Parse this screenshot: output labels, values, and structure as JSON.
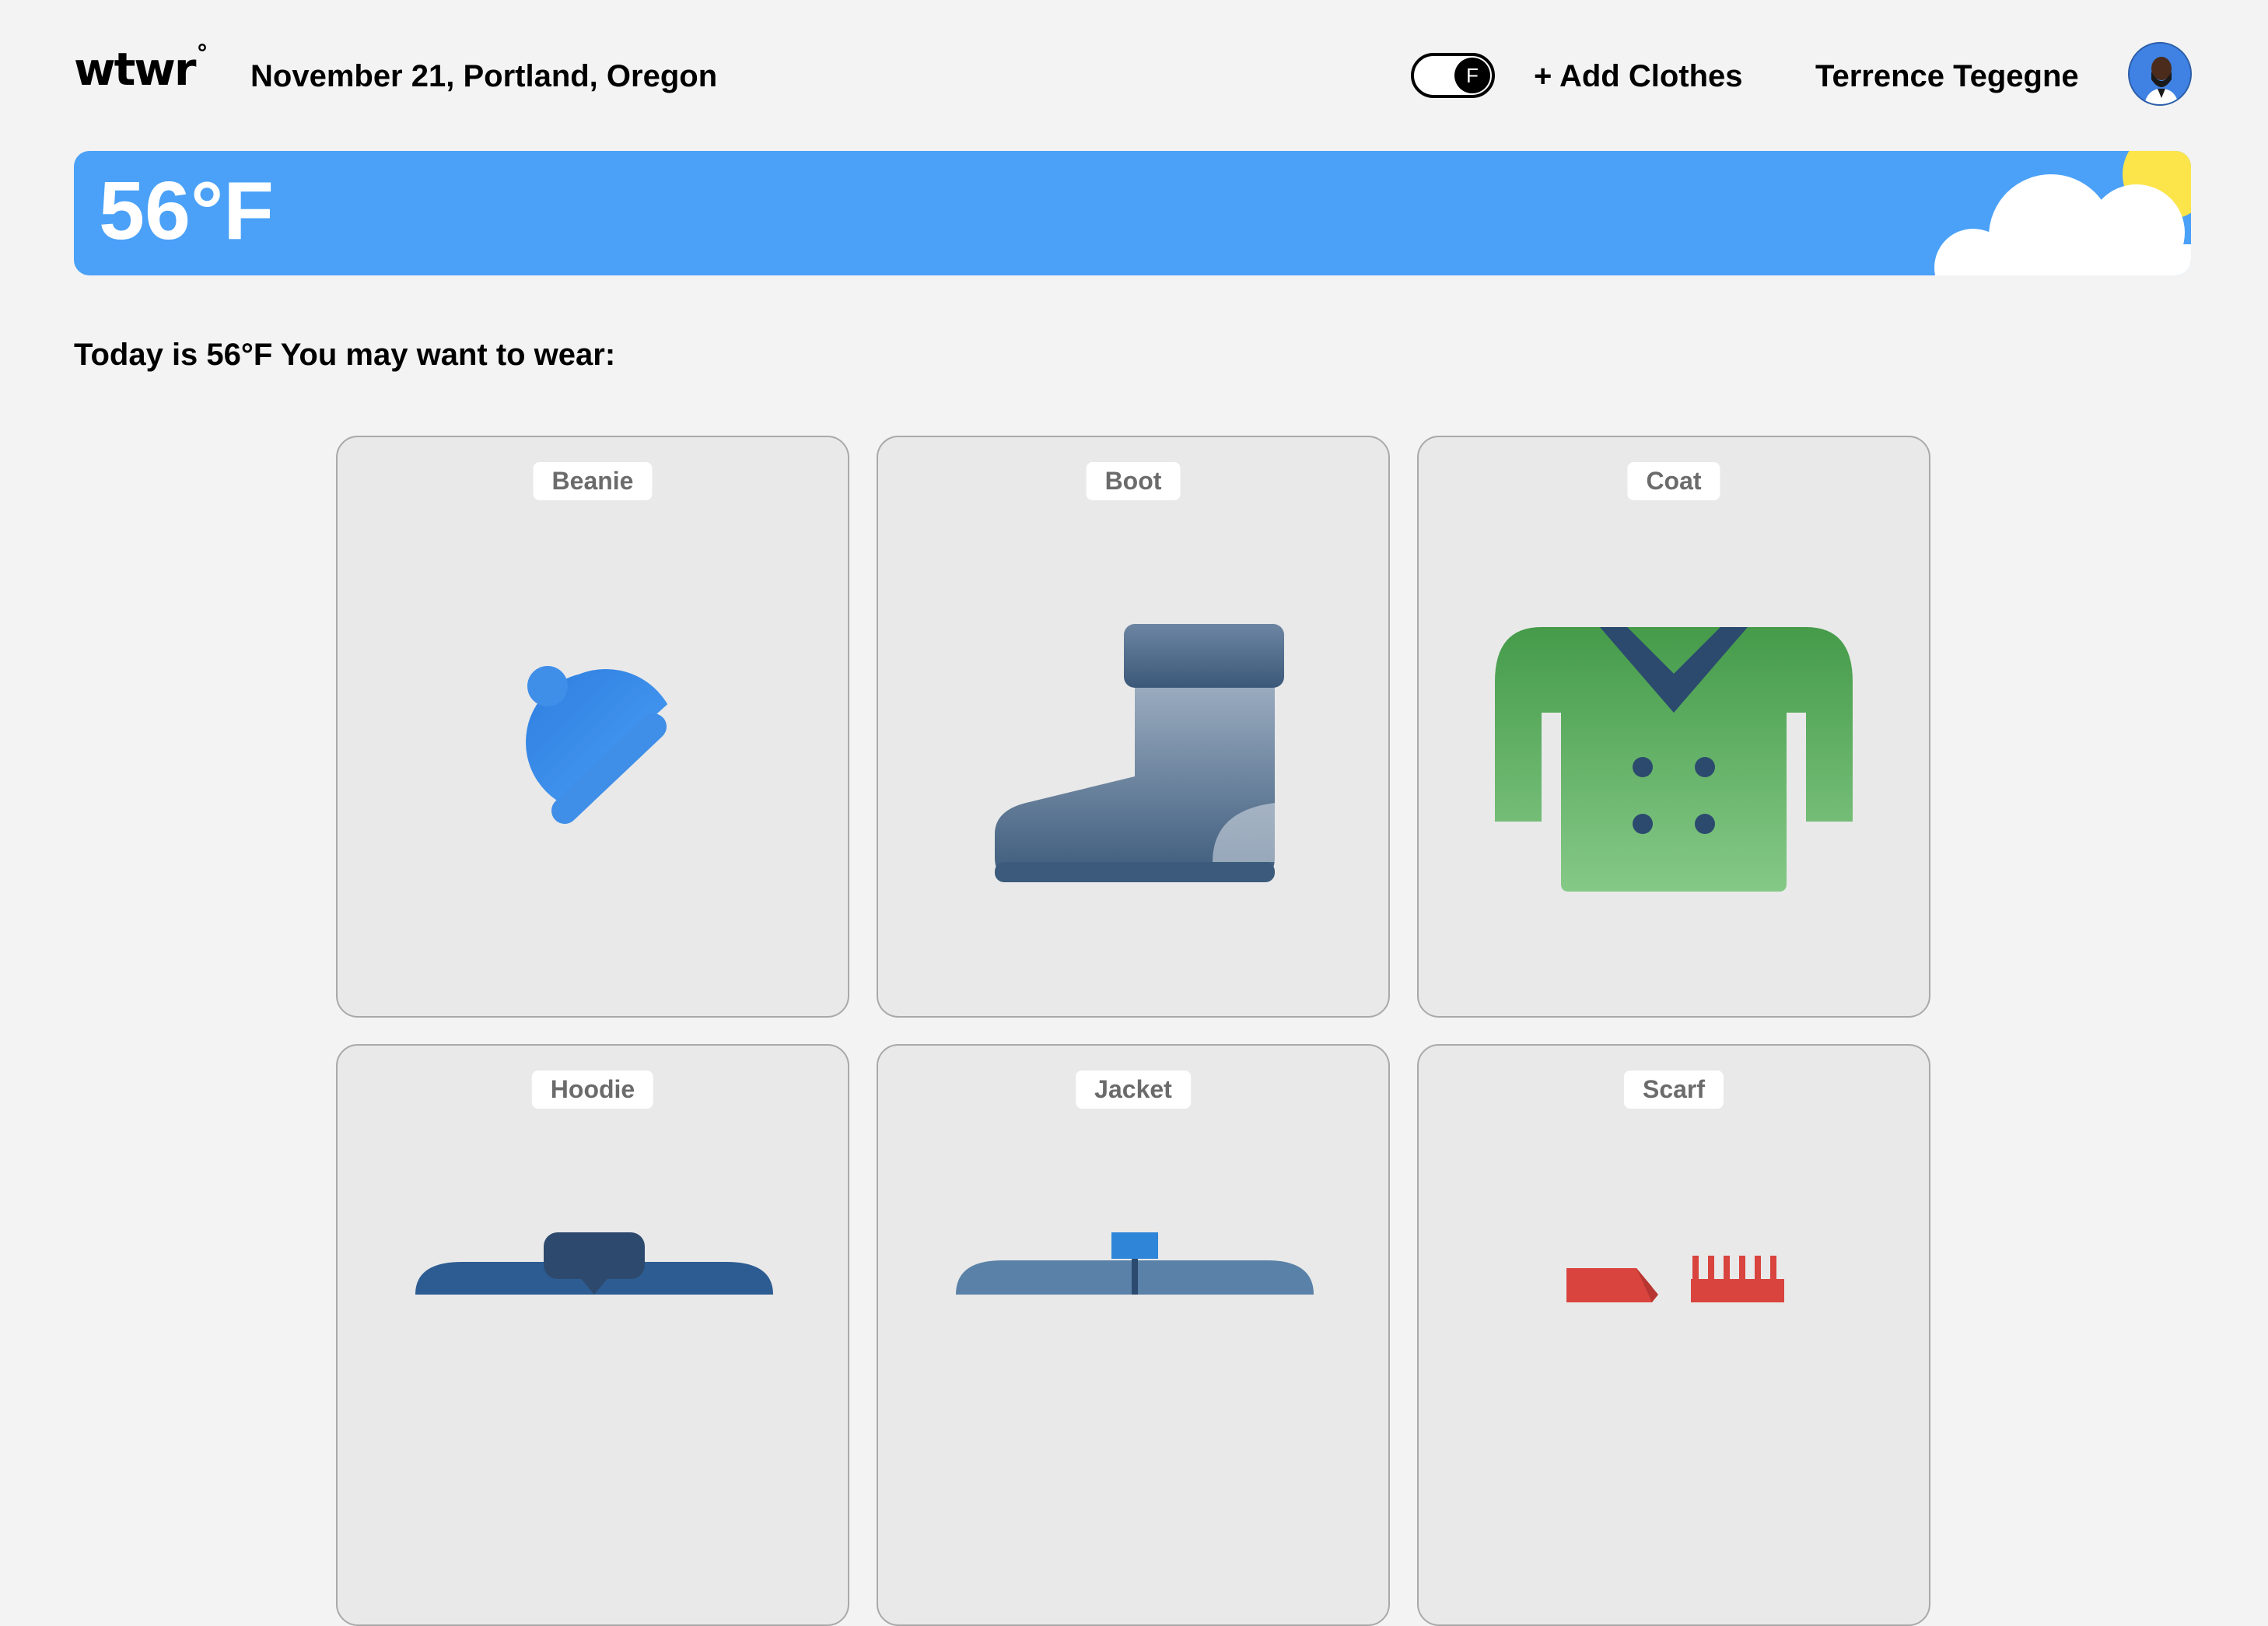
{
  "header": {
    "logo": "wtwr",
    "logo_degree": "°",
    "date_location": "November 21, Portland, Oregon",
    "temp_unit_toggle": "F",
    "add_clothes": "+ Add Clothes",
    "username": "Terrence Tegegne"
  },
  "weather": {
    "temperature": "56°F",
    "condition_icon": "sun-cloud-icon",
    "colors": {
      "banner": "#4aa1f7",
      "sun": "#fce54b",
      "cloud": "#ffffff"
    }
  },
  "main": {
    "prompt": "Today is 56°F You may want to wear:",
    "cards": [
      {
        "label": "Beanie",
        "icon": "beanie-icon"
      },
      {
        "label": "Boot",
        "icon": "boot-icon"
      },
      {
        "label": "Coat",
        "icon": "coat-icon"
      },
      {
        "label": "Hoodie",
        "icon": "hoodie-icon"
      },
      {
        "label": "Jacket",
        "icon": "jacket-icon"
      },
      {
        "label": "Scarf",
        "icon": "scarf-icon"
      }
    ]
  }
}
